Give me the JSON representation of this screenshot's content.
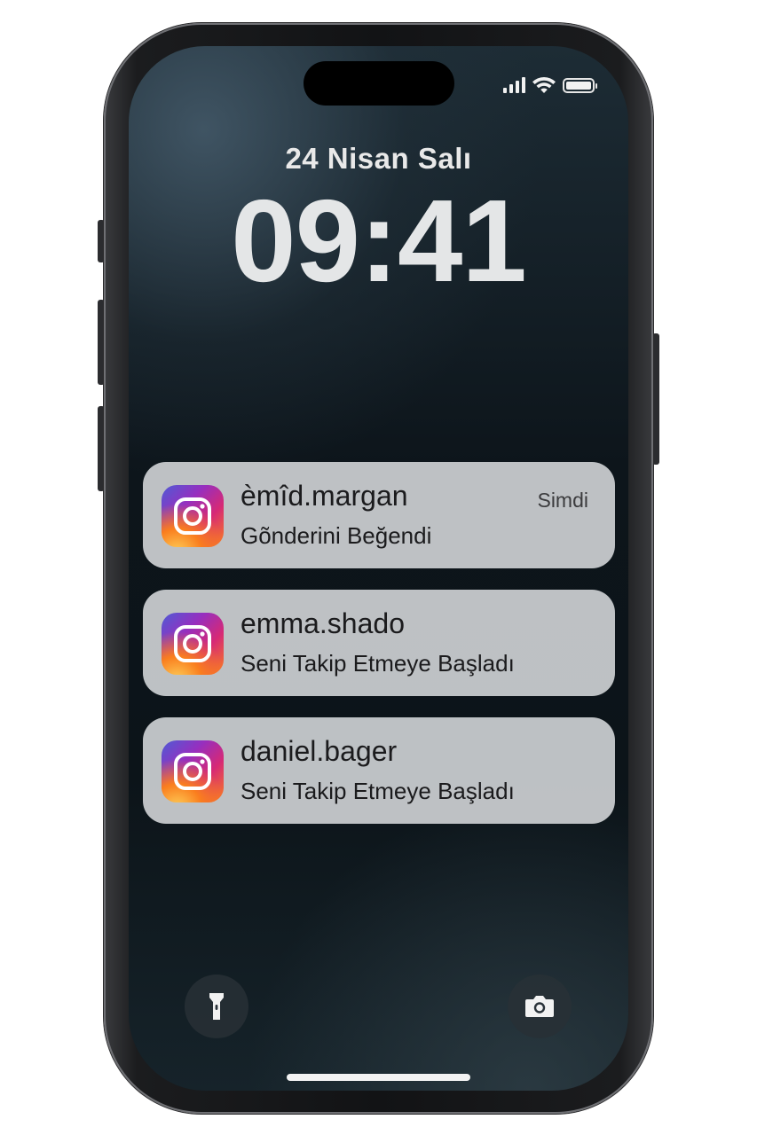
{
  "lock_screen": {
    "date": "24 Nisan Salı",
    "time": "09:41"
  },
  "status_bar": {
    "signal_icon": "cellular-signal-icon",
    "wifi_icon": "wifi-icon",
    "battery_icon": "battery-icon",
    "battery_level": 1.0
  },
  "notifications": [
    {
      "app_icon": "instagram-icon",
      "username": "èmîd.margan",
      "message": "Gõnderini Beğendi",
      "time": "Simdi"
    },
    {
      "app_icon": "instagram-icon",
      "username": "emma.shado",
      "message": "Seni Takip Etmeye Başladı"
    },
    {
      "app_icon": "instagram-icon",
      "username": "daniel.bager",
      "message": "Seni Takip Etmeye Başladı"
    }
  ],
  "quick_actions": {
    "left_icon": "flashlight-icon",
    "right_icon": "camera-icon"
  },
  "colors": {
    "notification_bg": "#cdd0d2",
    "clock_text": "#e4e6e7",
    "instagram_gradient_start": "#4f5bd5",
    "instagram_gradient_end": "#fa7e1e"
  }
}
